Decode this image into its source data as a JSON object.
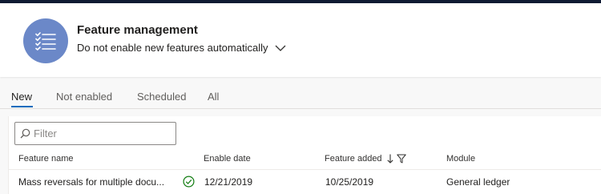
{
  "header": {
    "title": "Feature management",
    "subtitle": "Do not enable new features automatically",
    "icon": "checklist-icon",
    "icon_color": "#6b88c8"
  },
  "tabs": [
    {
      "label": "New",
      "active": true
    },
    {
      "label": "Not enabled",
      "active": false
    },
    {
      "label": "Scheduled",
      "active": false
    },
    {
      "label": "All",
      "active": false
    }
  ],
  "filter": {
    "placeholder": "Filter",
    "value": ""
  },
  "table": {
    "columns": [
      "Feature name",
      "Enable date",
      "Feature added",
      "Module"
    ],
    "sort_column": "Feature added",
    "rows": [
      {
        "feature_name": "Mass reversals for multiple docu...",
        "status_icon": "check-circle-icon",
        "enable_date": "12/21/2019",
        "feature_added": "10/25/2019",
        "module": "General ledger"
      }
    ]
  },
  "colors": {
    "accent": "#0f6cbd",
    "success": "#107c10",
    "top_bar": "#0f1a33"
  }
}
